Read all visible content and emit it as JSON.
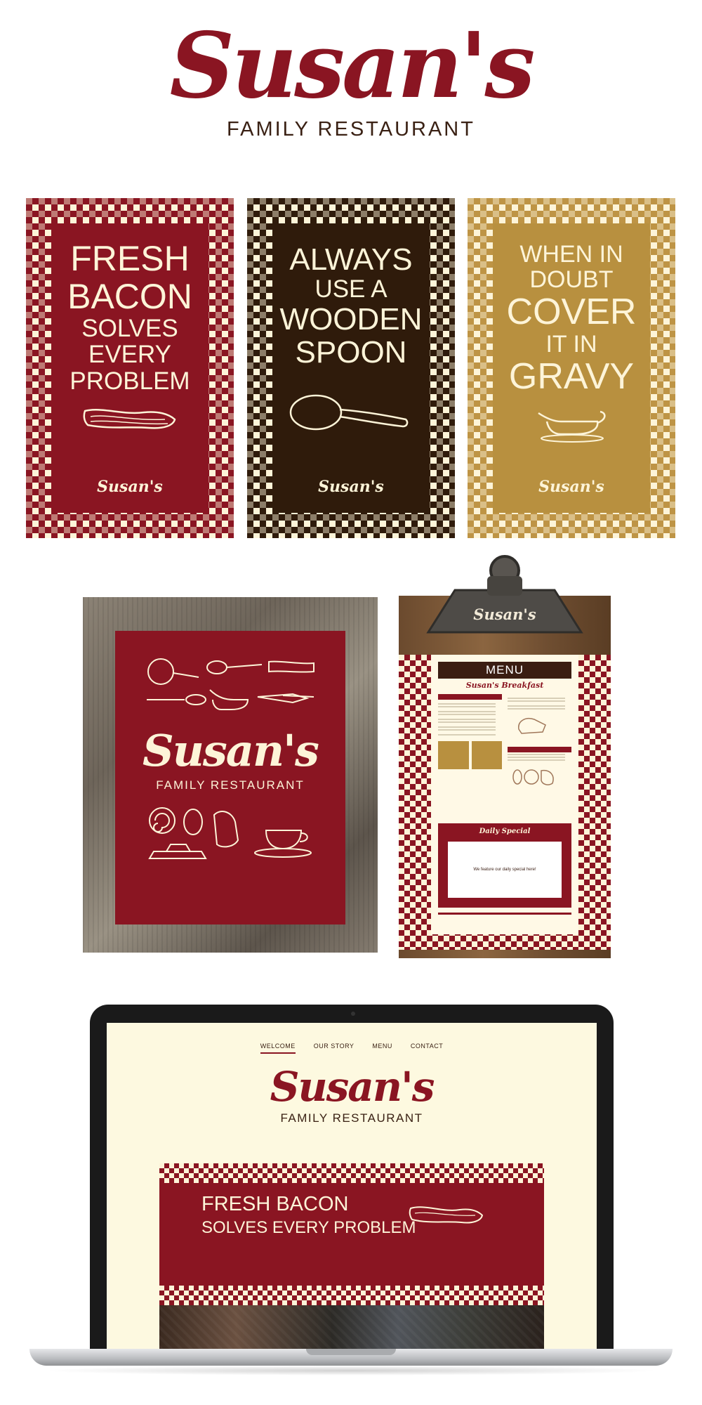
{
  "brand": {
    "name": "Susan's",
    "tagline": "FAMILY RESTAURANT",
    "colors": {
      "red": "#8a1522",
      "brown": "#2f1b0b",
      "gold": "#b8903f",
      "cream": "#fdf4d8"
    }
  },
  "posters": [
    {
      "lines": [
        "FRESH",
        "BACON",
        "SOLVES",
        "EVERY",
        "PROBLEM"
      ],
      "icon": "bacon-icon",
      "logo": "Susan's"
    },
    {
      "lines": [
        "ALWAYS",
        "USE A",
        "WOODEN",
        "SPOON"
      ],
      "icon": "wooden-spoon-icon",
      "logo": "Susan's"
    },
    {
      "lines": [
        "WHEN IN",
        "DOUBT",
        "COVER",
        "IT IN",
        "GRAVY"
      ],
      "icon": "gravy-boat-icon",
      "logo": "Susan's"
    }
  ],
  "framed_sign": {
    "logo": "Susan's",
    "tagline": "FAMILY RESTAURANT"
  },
  "menu": {
    "clip_logo": "Susan's",
    "title": "MENU",
    "subtitle": "Susan's Breakfast",
    "daily_special": {
      "title": "Daily Special",
      "text": "We feature our daily special here!"
    }
  },
  "website": {
    "nav": [
      "WELCOME",
      "OUR STORY",
      "MENU",
      "CONTACT"
    ],
    "logo": "Susan's",
    "tagline": "FAMILY RESTAURANT",
    "hero_line1": "FRESH BACON",
    "hero_line2": "SOLVES EVERY PROBLEM"
  }
}
